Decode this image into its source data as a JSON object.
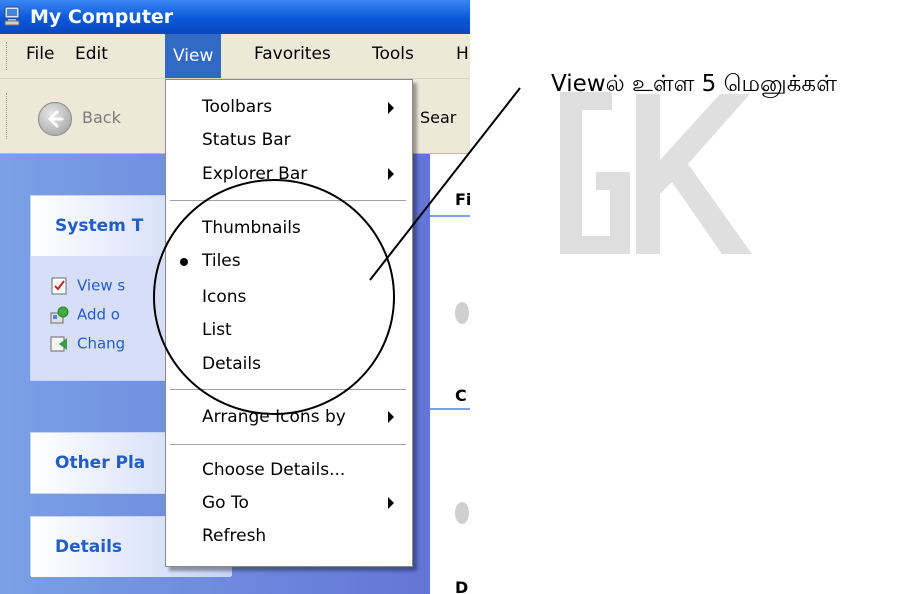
{
  "window": {
    "title": "My Computer",
    "icon": "my-computer-icon"
  },
  "menubar": {
    "items": [
      {
        "label": "File"
      },
      {
        "label": "Edit"
      },
      {
        "label": "View",
        "active": true
      },
      {
        "label": "Favorites"
      },
      {
        "label": "Tools"
      },
      {
        "label": "H"
      }
    ]
  },
  "toolbar": {
    "back_label": "Back",
    "search_label": "Sear"
  },
  "taskpane": {
    "system_tasks": {
      "title": "System T",
      "tasks": [
        {
          "label": "View s",
          "icon": "system-info-icon"
        },
        {
          "label": "Add o",
          "icon": "add-remove-programs-icon"
        },
        {
          "label": "Chang",
          "icon": "change-setting-icon"
        }
      ]
    },
    "other_places": {
      "title": "Other Pla"
    },
    "details": {
      "title": "Details"
    }
  },
  "content": {
    "section_letters": [
      "Fi",
      "D",
      "C"
    ]
  },
  "view_menu": {
    "items": [
      {
        "label": "Toolbars",
        "submenu": true
      },
      {
        "label": "Status Bar"
      },
      {
        "label": "Explorer Bar",
        "submenu": true
      },
      {
        "label": "Thumbnails"
      },
      {
        "label": "Tiles",
        "selected": true
      },
      {
        "label": "Icons"
      },
      {
        "label": "List"
      },
      {
        "label": "Details"
      },
      {
        "label": "Arrange Icons by",
        "submenu": true
      },
      {
        "label": "Choose Details..."
      },
      {
        "label": "Go To",
        "submenu": true
      },
      {
        "label": "Refresh"
      }
    ]
  },
  "annotation": {
    "text": "Viewல் உள்ள 5 மெனுக்கள்",
    "watermark": "GK"
  },
  "colors": {
    "titlebar": "#0a58d8",
    "menu_highlight": "#316ac5",
    "taskpane_bg": "#6375d6",
    "task_link": "#215dc6",
    "chrome": "#ece9d8",
    "watermark": "#d9d9d9"
  }
}
